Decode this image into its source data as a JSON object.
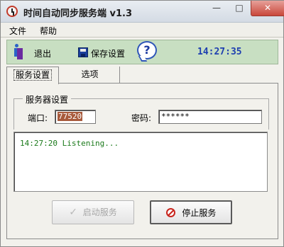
{
  "window": {
    "title": "时间自动同步服务端 v1.3",
    "minimize_label": "—",
    "maximize_label": "□",
    "close_label": "✕"
  },
  "menu": {
    "items": [
      {
        "label": "文件"
      },
      {
        "label": "帮助"
      }
    ]
  },
  "toolbar": {
    "exit_label": "退出",
    "save_label": "保存设置",
    "help_symbol": "?",
    "time": "14:27:35"
  },
  "tabs": [
    {
      "label": "服务设置",
      "active": true
    },
    {
      "label": "选项",
      "active": false
    }
  ],
  "server_settings": {
    "legend": "服务器设置",
    "port_label": "端口:",
    "port_value": "77520",
    "password_label": "密码:",
    "password_value": "******"
  },
  "log": {
    "lines": [
      "14:27:20 Listening..."
    ]
  },
  "buttons": {
    "start_label": "启动服务",
    "start_enabled": false,
    "stop_label": "停止服务"
  },
  "colors": {
    "toolbar_bg": "#c8dfc2",
    "clock": "#1e3fb0",
    "log_text": "#1b7a1b",
    "stop_icon": "#c8241c"
  }
}
